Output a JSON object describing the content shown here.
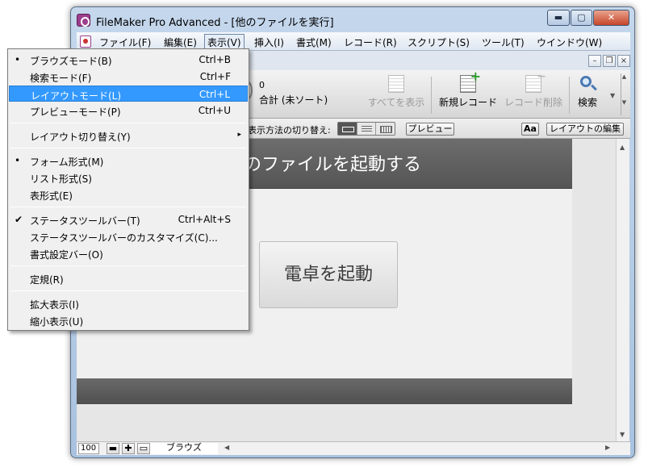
{
  "window": {
    "title": "FileMaker Pro Advanced - [他のファイルを実行]",
    "caption_minimize": "▬",
    "caption_maximize": "▢",
    "caption_close": "✕"
  },
  "menubar": {
    "items": [
      {
        "label": "ファイル(F)"
      },
      {
        "label": "編集(E)"
      },
      {
        "label": "表示(V)"
      },
      {
        "label": "挿入(I)"
      },
      {
        "label": "書式(M)"
      },
      {
        "label": "レコード(R)"
      },
      {
        "label": "スクリプト(S)"
      },
      {
        "label": "ツール(T)"
      },
      {
        "label": "ウインドウ(W)"
      }
    ]
  },
  "mdi": {
    "minimize": "–",
    "restore": "❐",
    "close": "×"
  },
  "toolbar": {
    "record_count": "0",
    "record_summary": "合計 (未ソート)",
    "show_all_label": "すべてを表示",
    "new_record_label": "新規レコード",
    "delete_record_label": "レコード削除",
    "search_label": "検索"
  },
  "layoutbar": {
    "view_as_label": "表示方法の切り替え:",
    "preview_label": "プレビュー",
    "aa_label": "Aa",
    "edit_layout_label": "レイアウトの編集"
  },
  "content": {
    "header_title": "のファイルを起動する",
    "calc_button_label": "電卓を起動"
  },
  "statusbar": {
    "zoom": "100",
    "zoom_out": "▬",
    "zoom_in": "✚",
    "mode": "ブラウズ"
  },
  "dropdown": {
    "items": [
      {
        "label": "ブラウズモード(B)",
        "shortcut": "Ctrl+B",
        "mark": "•"
      },
      {
        "label": "検索モード(F)",
        "shortcut": "Ctrl+F",
        "mark": ""
      },
      {
        "label": "レイアウトモード(L)",
        "shortcut": "Ctrl+L",
        "mark": ""
      },
      {
        "label": "プレビューモード(P)",
        "shortcut": "Ctrl+U",
        "mark": ""
      },
      {
        "label": "レイアウト切り替え(Y)",
        "shortcut": "",
        "mark": "",
        "submenu": "▸"
      },
      {
        "label": "フォーム形式(M)",
        "shortcut": "",
        "mark": "•"
      },
      {
        "label": "リスト形式(S)",
        "shortcut": "",
        "mark": ""
      },
      {
        "label": "表形式(E)",
        "shortcut": "",
        "mark": ""
      },
      {
        "label": "ステータスツールバー(T)",
        "shortcut": "Ctrl+Alt+S",
        "mark": "✔"
      },
      {
        "label": "ステータスツールバーのカスタマイズ(C)...",
        "shortcut": "",
        "mark": ""
      },
      {
        "label": "書式設定バー(O)",
        "shortcut": "",
        "mark": ""
      },
      {
        "label": "定規(R)",
        "shortcut": "",
        "mark": ""
      },
      {
        "label": "拡大表示(I)",
        "shortcut": "",
        "mark": ""
      },
      {
        "label": "縮小表示(U)",
        "shortcut": "",
        "mark": ""
      }
    ]
  }
}
